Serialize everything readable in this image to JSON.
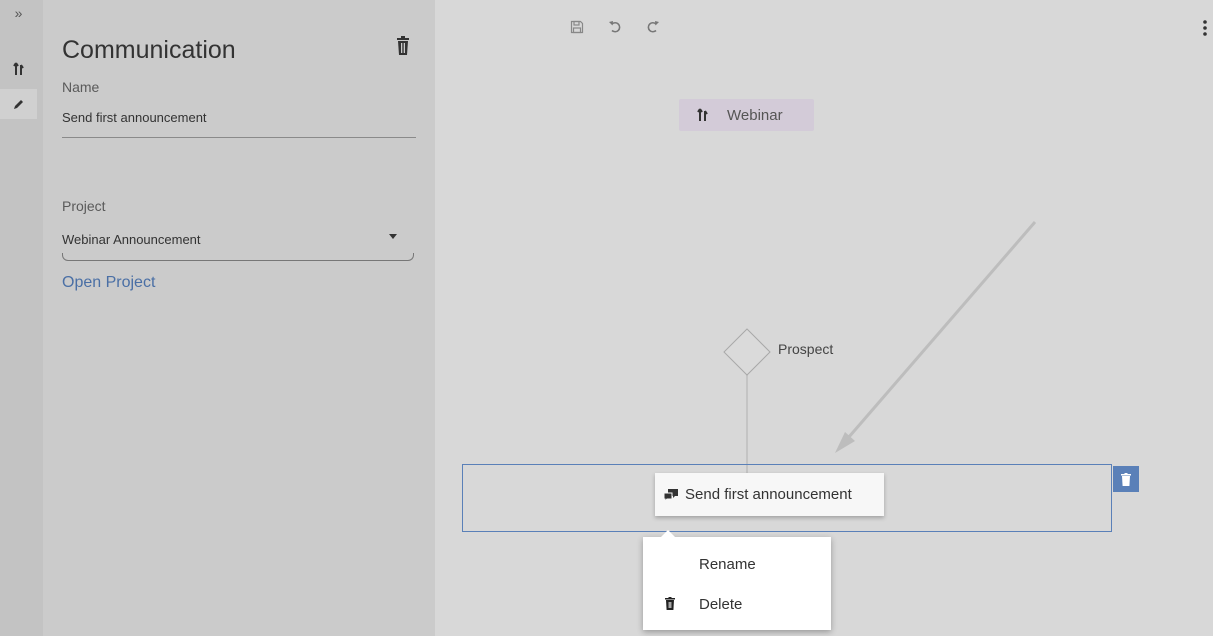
{
  "rail": {
    "expand_glyph": "»",
    "items": [
      {
        "icon": "split-flow-icon",
        "active": false
      },
      {
        "icon": "pencil-icon",
        "active": true
      }
    ]
  },
  "panel": {
    "title": "Communication",
    "name_label": "Name",
    "name_value": "Send first announcement",
    "project_label": "Project",
    "project_value": "Webinar Announcement",
    "open_project_link": "Open Project"
  },
  "toolbar": {
    "icons": [
      "save-icon",
      "undo-icon",
      "redo-icon"
    ]
  },
  "canvas": {
    "source_node_label": "Webinar",
    "decision_label": "Prospect",
    "step_node_label": "Send first announcement"
  },
  "context_menu": {
    "rename_label": "Rename",
    "delete_label": "Delete"
  },
  "colors": {
    "accent": "#5a80b8",
    "link": "#4a6fa5",
    "source_node_bg": "#d3cbd8",
    "panel_bg": "#cbcbcb",
    "canvas_bg": "#d8d8d8"
  }
}
